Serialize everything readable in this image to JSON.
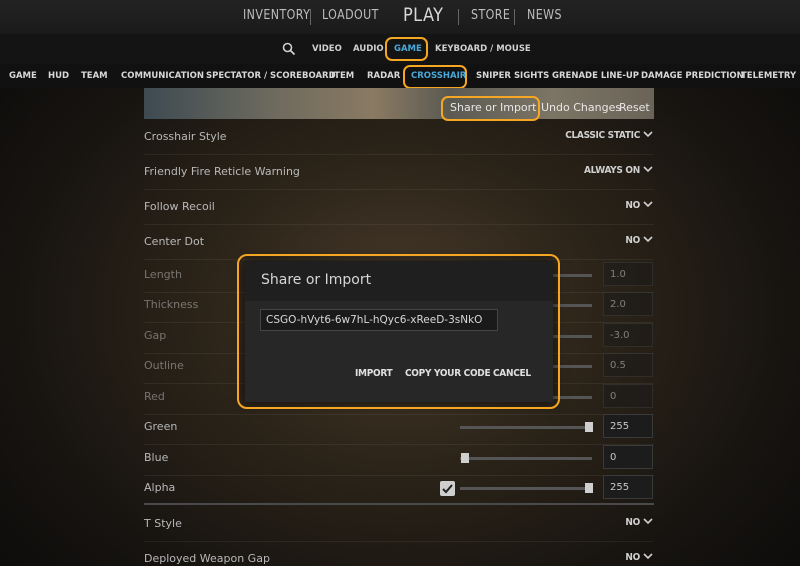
{
  "topnav": {
    "inventory": "INVENTORY",
    "loadout": "LOADOUT",
    "play": "PLAY",
    "store": "STORE",
    "news": "NEWS"
  },
  "subnav": {
    "search_icon": "search-icon",
    "video": "VIDEO",
    "audio": "AUDIO",
    "game": "GAME",
    "keyboard_mouse": "KEYBOARD / MOUSE"
  },
  "tabs": [
    "GAME",
    "HUD",
    "TEAM",
    "COMMUNICATION",
    "SPECTATOR / SCOREBOARD",
    "ITEM",
    "RADAR",
    "CROSSHAIR",
    "SNIPER SIGHTS",
    "GRENADE LINE-UP",
    "DAMAGE PREDICTION",
    "TELEMETRY"
  ],
  "active_tab": "CROSSHAIR",
  "preview": {
    "share_import": "Share or Import",
    "undo_changes": "Undo Changes",
    "reset": "Reset"
  },
  "settings": {
    "crosshair_style": {
      "label": "Crosshair Style",
      "value": "CLASSIC STATIC"
    },
    "friendly_fire": {
      "label": "Friendly Fire Reticle Warning",
      "value": "ALWAYS ON"
    },
    "follow_recoil": {
      "label": "Follow Recoil",
      "value": "NO"
    },
    "center_dot": {
      "label": "Center Dot",
      "value": "NO"
    },
    "length": {
      "label": "Length",
      "value": "1.0"
    },
    "thickness": {
      "label": "Thickness",
      "value": "2.0"
    },
    "gap": {
      "label": "Gap",
      "value": "-3.0"
    },
    "outline": {
      "label": "Outline",
      "value": "0.5"
    },
    "red": {
      "label": "Red",
      "value": "0"
    },
    "green": {
      "label": "Green",
      "value": "255"
    },
    "blue": {
      "label": "Blue",
      "value": "0"
    },
    "alpha": {
      "label": "Alpha",
      "value": "255"
    },
    "t_style": {
      "label": "T Style",
      "value": "NO"
    },
    "deployed_gap": {
      "label": "Deployed Weapon Gap",
      "value": "NO"
    }
  },
  "modal": {
    "title": "Share or Import",
    "code": "CSGO-hVyt6-6w7hL-hQyc6-xReeD-3sNkO",
    "import": "IMPORT",
    "copy": "COPY YOUR CODE",
    "cancel": "CANCEL"
  },
  "colors": {
    "highlight": "#f5a623",
    "active_tab": "#4aa8d8"
  }
}
